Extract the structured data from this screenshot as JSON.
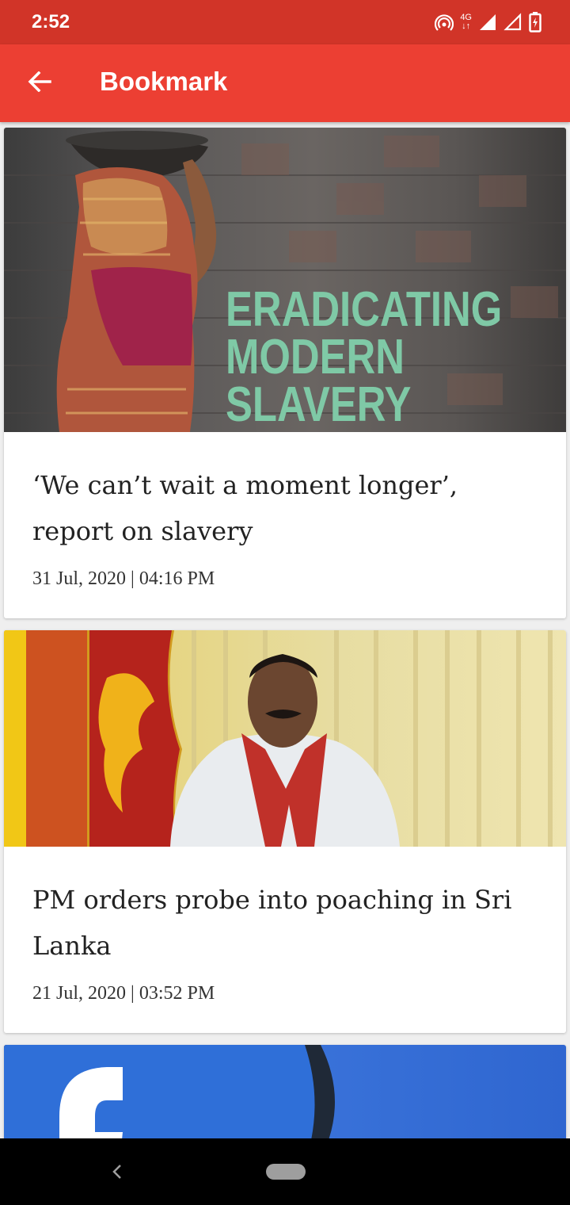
{
  "status_bar": {
    "time": "2:52",
    "network": "4G"
  },
  "app_bar": {
    "title": "Bookmark"
  },
  "articles": [
    {
      "image_text": [
        "ERADICATING",
        "MODERN",
        "SLAVERY"
      ],
      "title": "‘We can’t wait a moment longer’, report on slavery",
      "date": "31 Jul, 2020 | 04:16 PM"
    },
    {
      "title": "PM orders probe into poaching in Sri Lanka",
      "date": "21 Jul, 2020 | 03:52 PM"
    },
    {
      "title": "",
      "date": ""
    }
  ],
  "colors": {
    "status_bar": "#d13428",
    "app_bar": "#ec3f33",
    "background": "#efefef"
  }
}
